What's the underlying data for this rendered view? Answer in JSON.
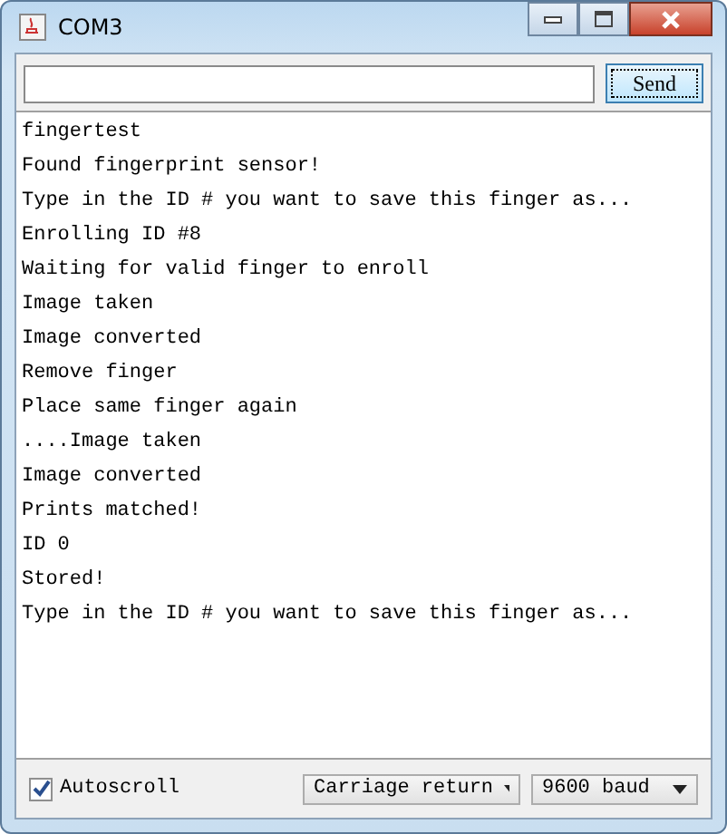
{
  "window": {
    "title": "COM3"
  },
  "send_button": "Send",
  "output_lines": [
    "fingertest",
    "Found fingerprint sensor!",
    "Type in the ID # you want to save this finger as...",
    "Enrolling ID #8",
    "Waiting for valid finger to enroll",
    "Image taken",
    "Image converted",
    "Remove finger",
    "Place same finger again",
    "....Image taken",
    "Image converted",
    "Prints matched!",
    "ID 0",
    "Stored!",
    "Type in the ID # you want to save this finger as..."
  ],
  "autoscroll": {
    "label": "Autoscroll",
    "checked": true
  },
  "line_ending": "Carriage return",
  "baud_rate": "9600 baud"
}
